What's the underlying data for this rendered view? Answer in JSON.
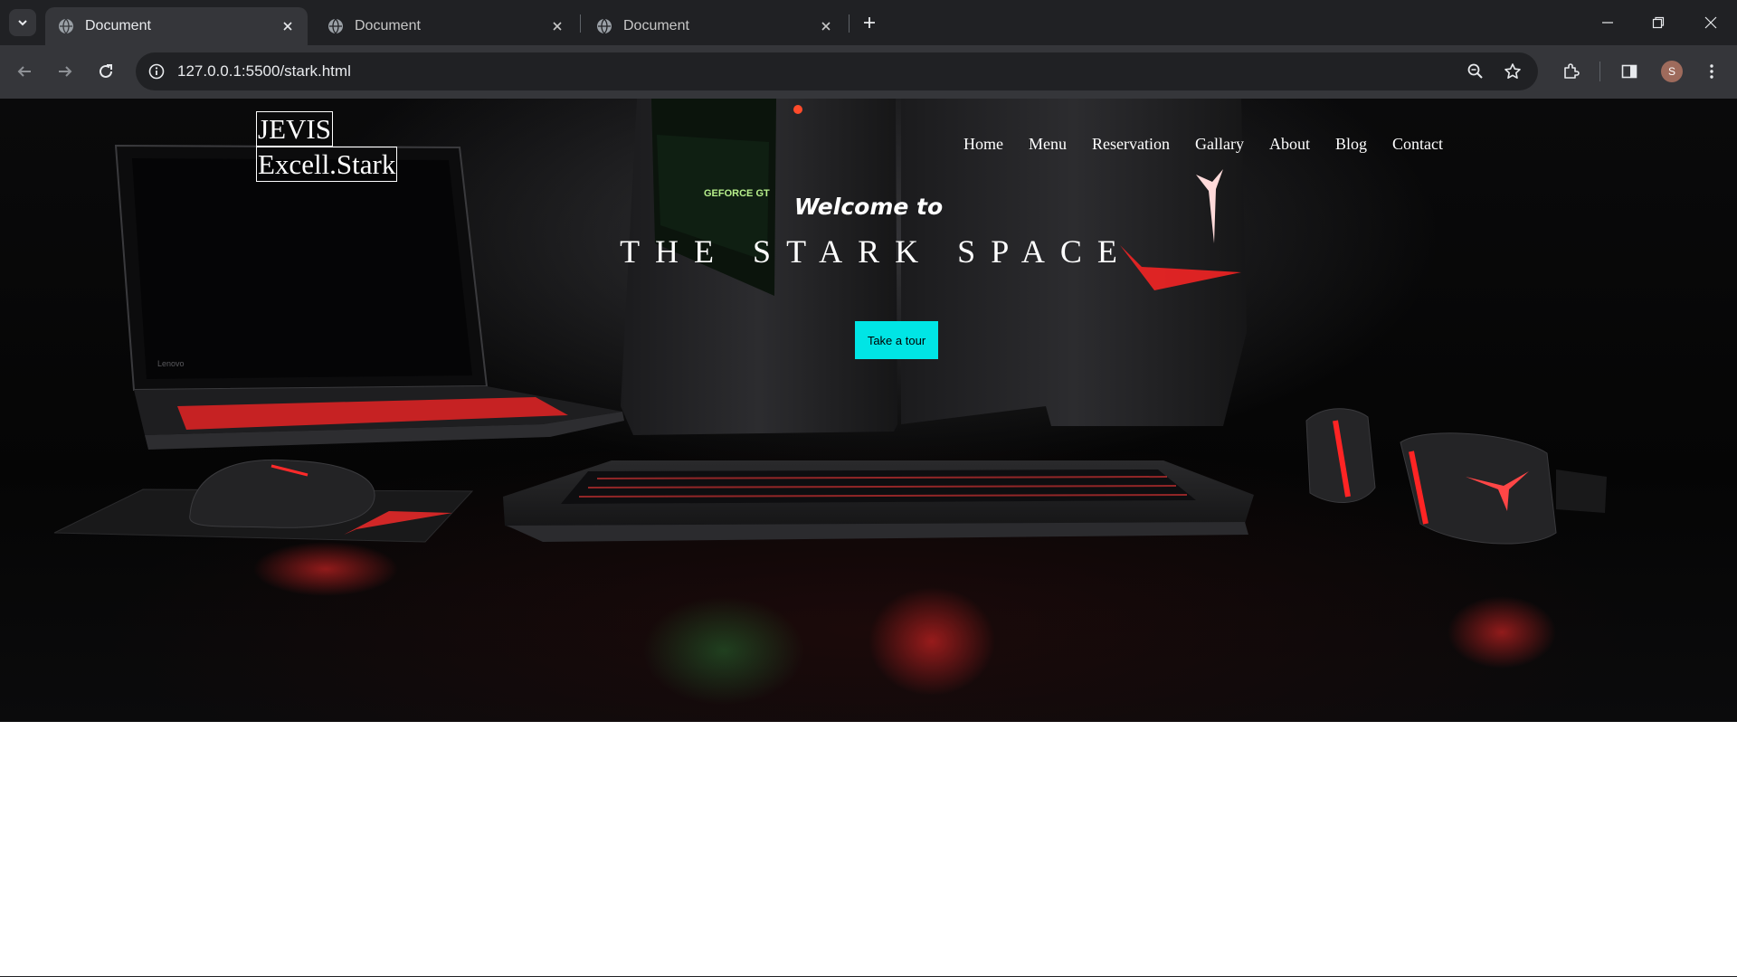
{
  "browser": {
    "tabs": [
      {
        "title": "Document",
        "active": true
      },
      {
        "title": "Document",
        "active": false
      },
      {
        "title": "Document",
        "active": false
      }
    ],
    "address_bar": {
      "url": "127.0.0.1:5500/stark.html"
    },
    "profile_initial": "S",
    "icons": [
      "tab-search-icon",
      "globe-icon",
      "close-icon",
      "plus-icon",
      "minimize-icon",
      "restore-icon",
      "back-icon",
      "forward-icon",
      "reload-icon",
      "info-icon",
      "zoom-icon",
      "star-icon",
      "extensions-icon",
      "side-panel-icon",
      "more-icon"
    ]
  },
  "page": {
    "logo": {
      "line1": "JEVIS",
      "line2": "Excell.Stark"
    },
    "nav": [
      "Home",
      "Menu",
      "Reservation",
      "Gallary",
      "About",
      "Blog",
      "Contact"
    ],
    "hero": {
      "welcome": "Welcome to",
      "headline": "THE STARK SPACE",
      "cta": "Take a tour"
    },
    "scene_labels": {
      "laptop_brand": "Lenovo",
      "gpu_label": "GEFORCE GT"
    },
    "colors": {
      "accent_cyan": "#00e5e5",
      "hero_red": "#ff2a2a",
      "chrome_dark": "#202124",
      "chrome_toolbar": "#35363a"
    }
  }
}
